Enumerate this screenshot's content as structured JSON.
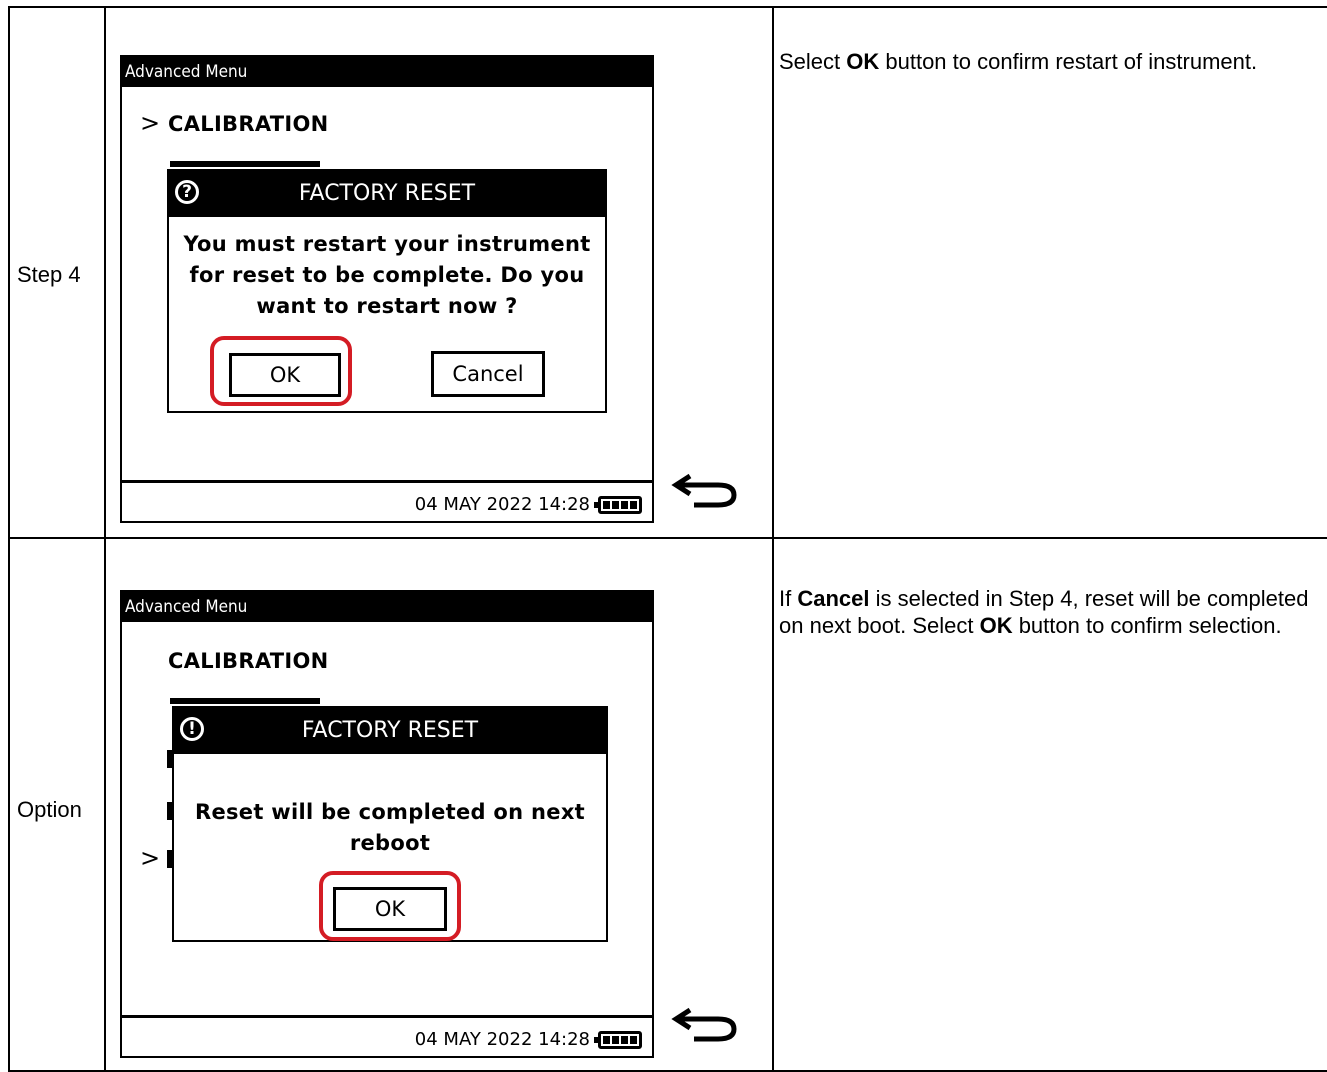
{
  "rows": [
    {
      "label": "Step 4",
      "screen": {
        "title": "Advanced Menu",
        "chevron": ">",
        "menu_item": "CALIBRATION",
        "dialog": {
          "icon": "question-icon",
          "icon_glyph": "?",
          "title": "FACTORY RESET",
          "message_lines": [
            "You must restart your instrument",
            "for reset to be complete. Do you",
            "want to restart now ?"
          ],
          "ok_label": "OK",
          "cancel_label": "Cancel"
        },
        "status_datetime": "04 MAY 2022 14:28"
      },
      "description": {
        "pre": "Select ",
        "bold": "OK",
        "post": " button to confirm restart of instrument."
      }
    },
    {
      "label": "Option",
      "screen": {
        "title": "Advanced Menu",
        "chevron": ">",
        "menu_item": "CALIBRATION",
        "dialog": {
          "icon": "exclamation-icon",
          "icon_glyph": "!",
          "title": "FACTORY RESET",
          "message_lines": [
            "Reset will be completed on next",
            "reboot"
          ],
          "ok_label": "OK"
        },
        "status_datetime": "04 MAY 2022 14:28"
      },
      "description": {
        "pre": "If ",
        "bold": "Cancel",
        "mid": " is selected in Step 4, reset will be completed on next boot. Select ",
        "bold2": "OK",
        "post": " button to confirm selection."
      }
    }
  ],
  "colors": {
    "highlight": "#d41c24",
    "screen_bg": "#ffffff",
    "bar": "#000000"
  },
  "icons": {
    "back": "back-arrow-icon",
    "battery": "battery-full-icon"
  }
}
